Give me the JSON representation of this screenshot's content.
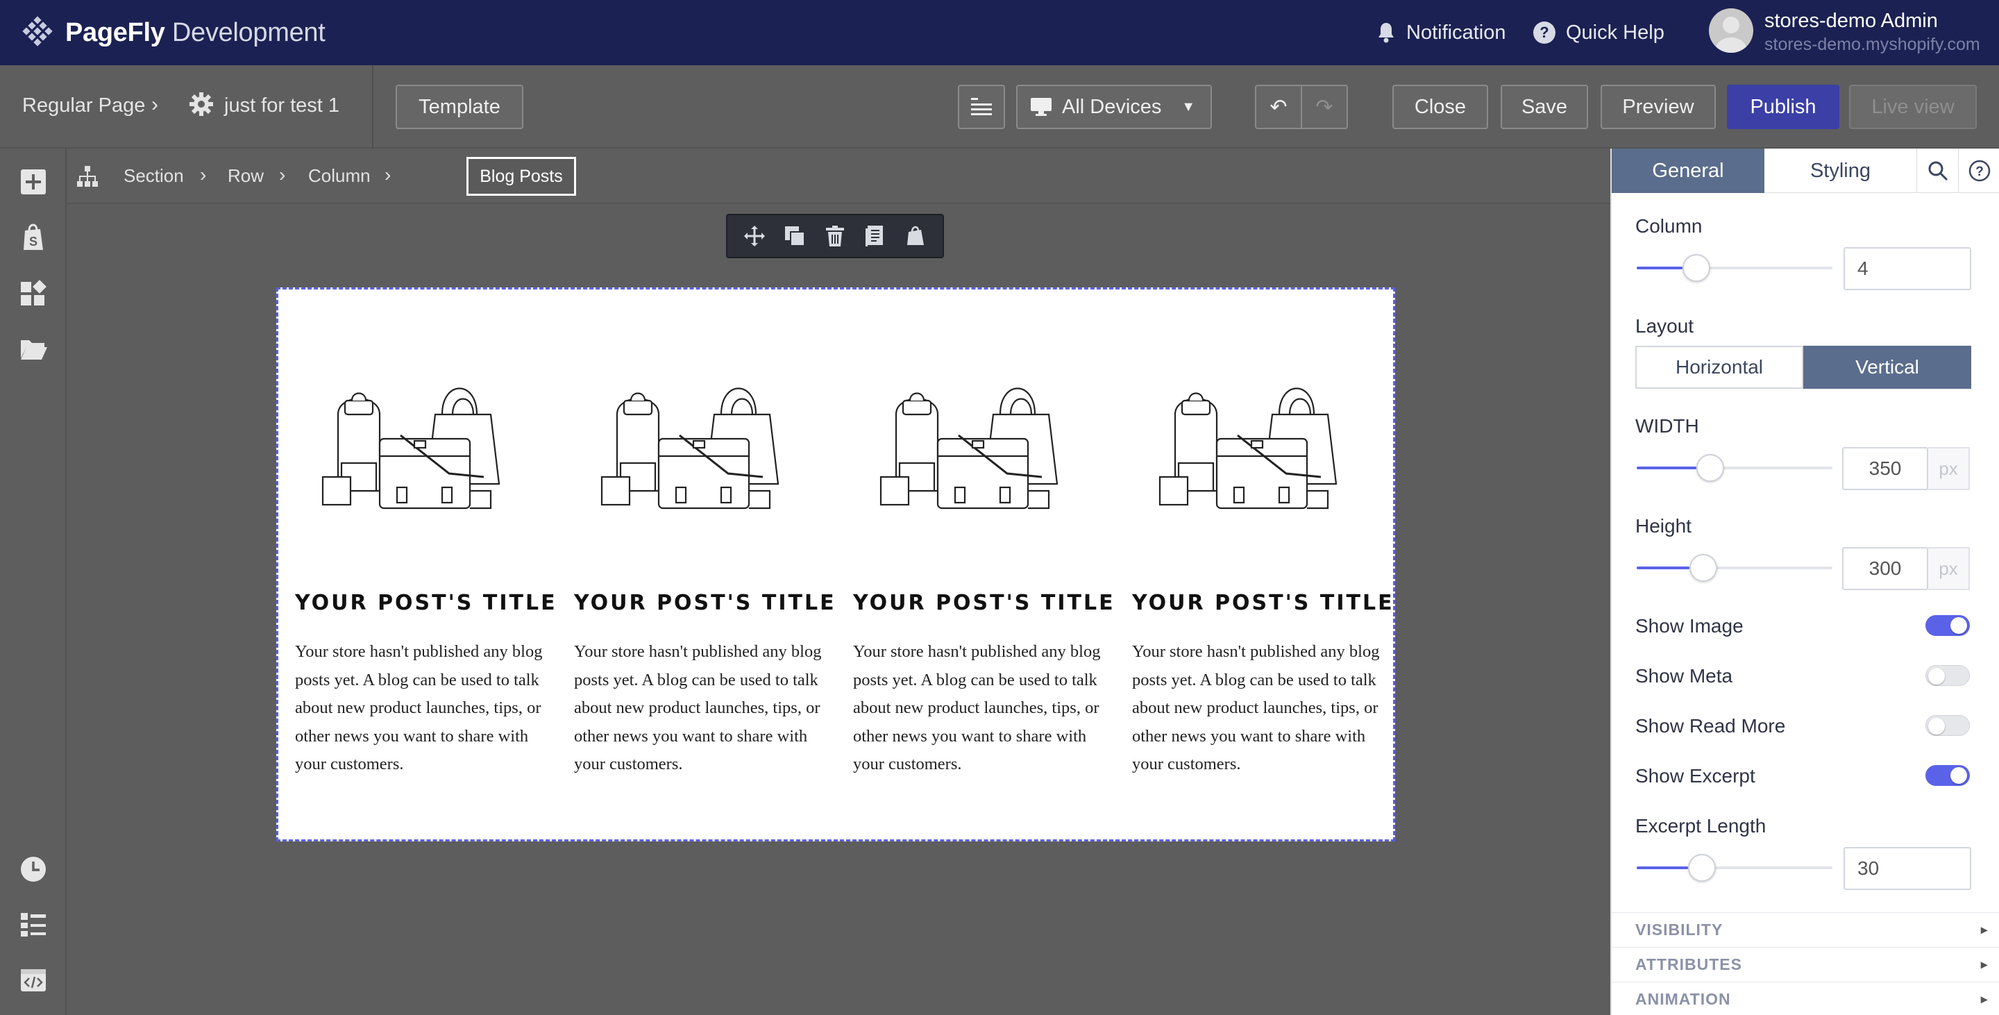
{
  "app": {
    "brand_bold": "PageFly",
    "brand_light": "Development"
  },
  "header": {
    "notification_label": "Notification",
    "help_label": "Quick Help",
    "user_name": "stores-demo Admin",
    "user_domain": "stores-demo.myshopify.com"
  },
  "toolbar": {
    "page_type": "Regular Page",
    "page_name": "just for test 1",
    "template_label": "Template",
    "devices_label": "All Devices",
    "close_label": "Close",
    "save_label": "Save",
    "preview_label": "Preview",
    "publish_label": "Publish",
    "live_view_label": "Live view"
  },
  "breadcrumb": {
    "items": [
      "Section",
      "Row",
      "Column"
    ],
    "active": "Blog Posts"
  },
  "posts": [
    {
      "title": "YOUR POST'S TITLE",
      "excerpt": "Your store hasn't published any blog posts yet. A blog can be used to talk about new product launches, tips, or other news you want to share with your customers."
    },
    {
      "title": "YOUR POST'S TITLE",
      "excerpt": "Your store hasn't published any blog posts yet. A blog can be used to talk about new product launches, tips, or other news you want to share with your customers."
    },
    {
      "title": "YOUR POST'S TITLE",
      "excerpt": "Your store hasn't published any blog posts yet. A blog can be used to talk about new product launches, tips, or other news you want to share with your customers."
    },
    {
      "title": "YOUR POST'S TITLE",
      "excerpt": "Your store hasn't published any blog posts yet. A blog can be used to talk about new product launches, tips, or other news you want to share with your customers."
    }
  ],
  "panel": {
    "tab_general": "General",
    "tab_styling": "Styling",
    "column_label": "Column",
    "column_value": "4",
    "layout_label": "Layout",
    "layout_horizontal": "Horizontal",
    "layout_vertical": "Vertical",
    "width_label": "WIDTH",
    "width_value": "350",
    "height_label": "Height",
    "height_value": "300",
    "unit_px": "px",
    "show_image_label": "Show Image",
    "show_image": true,
    "show_meta_label": "Show Meta",
    "show_meta": false,
    "show_read_more_label": "Show Read More",
    "show_read_more": false,
    "show_excerpt_label": "Show Excerpt",
    "show_excerpt": true,
    "excerpt_length_label": "Excerpt Length",
    "excerpt_length_value": "30",
    "sections": [
      "VISIBILITY",
      "ATTRIBUTES",
      "ANIMATION"
    ]
  },
  "colors": {
    "header_bg": "#1b2152",
    "accent": "#5a63e8",
    "publish": "#3b3fa6",
    "tab_active": "#5b6d8c"
  }
}
